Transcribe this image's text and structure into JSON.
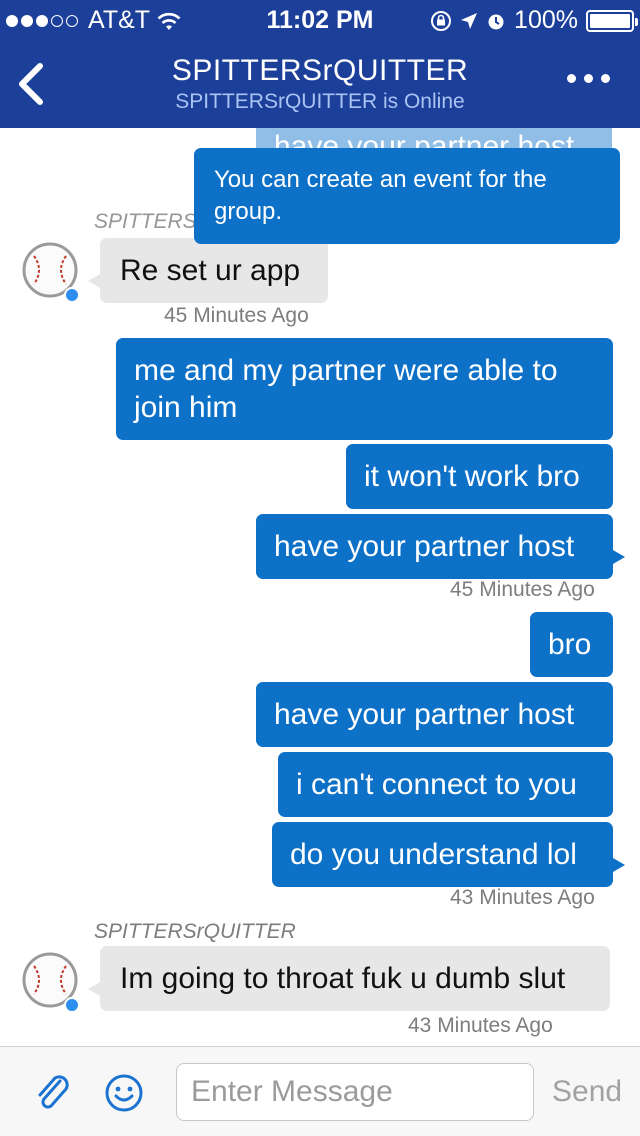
{
  "status_bar": {
    "carrier": "AT&T",
    "time": "11:02 PM",
    "battery": "100%"
  },
  "nav": {
    "title": "SPITTERSrQUITTER",
    "subtitle": "SPITTERSrQUITTER is Online"
  },
  "messages": {
    "out_partial": "have your partner host",
    "out_group": "You can create an event for the group.",
    "in_sender_1": "SPITTERSrQUITTER",
    "in_reset": "Re set ur app",
    "in_reset_time": "45 Minutes Ago",
    "out_me_partner": "me and my partner were able to join him",
    "out_wont_work": "it won't work bro",
    "out_host_1": "have your partner host",
    "out_host_1_time": "45 Minutes Ago",
    "out_bro": "bro",
    "out_host_2": "have your partner host",
    "out_cant_connect": "i can't connect to you",
    "out_understand": "do you understand lol",
    "out_understand_time": "43 Minutes Ago",
    "in_sender_2": "SPITTERSrQUITTER",
    "in_threat": "Im going to throat fuk u dumb slut",
    "in_threat_time": "43 Minutes Ago"
  },
  "composer": {
    "placeholder": "Enter Message",
    "send_label": "Send"
  },
  "colors": {
    "header": "#1c3f9a",
    "bubble_out": "#0e71c8",
    "bubble_in": "#e7e7e7"
  }
}
